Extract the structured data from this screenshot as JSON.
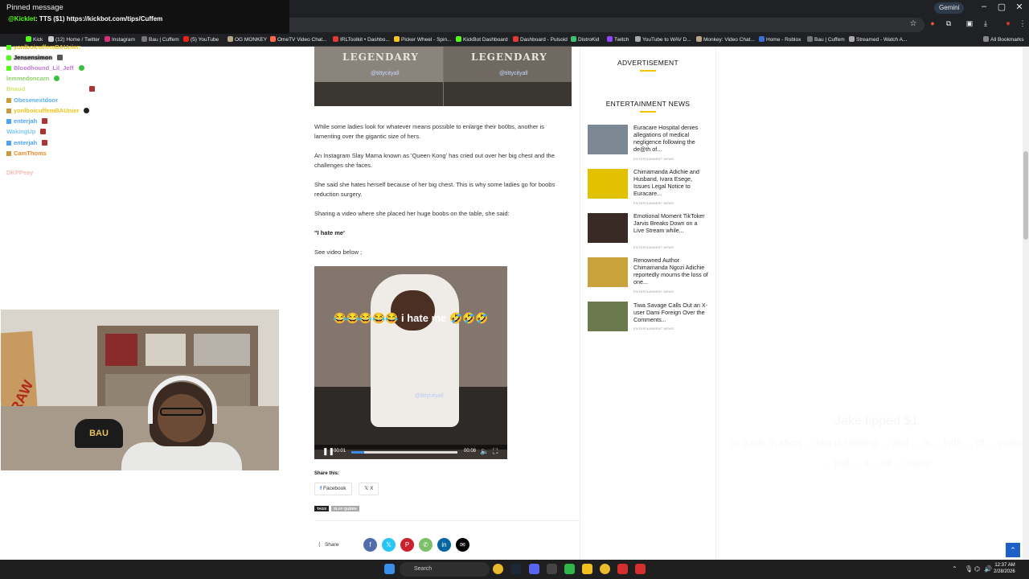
{
  "browser": {
    "url": "...aebidinho.ng/...-slay-mama-... big chest photos/",
    "gemini_label": "Gemini",
    "bookmarks": [
      "Kick",
      "(12) Home / Twitter",
      "Instagram",
      "Bau | Cuffem",
      "(5) YouTube",
      "OG MONKEY",
      "OmeTV Video Chat...",
      "IRLToolkit • Dashbo...",
      "Picker Wheel - Spin...",
      "KickBot Dashboard",
      "Dashboard - Pulsoid",
      "DistroKid",
      "Twitch",
      "YouTube to WAV D...",
      "Monkey: Video Chat...",
      "Home - Roblox",
      "Bau | Cuffem",
      "Streamed - Watch A..."
    ],
    "all_bookmarks": "All Bookmarks"
  },
  "overlay": {
    "pinned_title": "Pinned message",
    "pinned_user": "@Kicklet",
    "pinned_text": ": TTS ($1) https://kickbot.com/tips/Cuffem",
    "chat": [
      {
        "user": "yonlboicuffemBAUnier:",
        "color": "#f0c419"
      },
      {
        "user": "Jensensimon",
        "color": "#e6e6e6"
      },
      {
        "user": "Bloodhound_Lil_Jeff",
        "color": "#c07ad9"
      },
      {
        "user": "lemmedoncarn",
        "color": "#8fd16b"
      },
      {
        "user": "Bnaud",
        "color": "#d7e36c"
      },
      {
        "user": "Obesenextdoor",
        "color": "#5ab0f0"
      },
      {
        "user": "yonlboicuffemBAUnier",
        "color": "#f0c419"
      },
      {
        "user": "enterjah",
        "color": "#4fa3f7"
      },
      {
        "user": "WakingUp",
        "color": "#7ec8f5"
      },
      {
        "user": "enterjah",
        "color": "#4fa3f7"
      },
      {
        "user": "CamThoms",
        "color": "#f08a24"
      },
      {
        "user": "DKPPeay",
        "color": "#e07b6e"
      }
    ],
    "webcam_hat_text": "BAU",
    "webcam_board_text": "RAW",
    "tip_title": "Jake tipped $1",
    "tip_body": "to 0 ads in short ... she is reading ... and ... is ... with ... of ... video ... pull ... a ... of ... video"
  },
  "article": {
    "hero_caption": "LEGENDARY",
    "hero_watermark": "@tittycityall",
    "paragraphs": [
      "While some ladies look for whatever means possible to enlarge their bo0bs, another is lamenting over the gigantic size of hers.",
      "An Instagram Slay Mama known as 'Queen Kong' has cried out over her big chest and the challenges she faces.",
      "She said she hates herself because of her big chest. This is why some ladies go for boobs reduction surgery.",
      "Sharing a video where she placed her huge boobs on the table, she said:"
    ],
    "quote": "\"I hate me'",
    "see_video": "See video below ;",
    "video": {
      "caption": "😂😂😂😂😂 i hate me 🤣🤣🤣",
      "watermark": "@tittycityall",
      "current_time": "00:01",
      "duration": "00:08",
      "progress_fraction": 0.12
    },
    "share_this": "Share this:",
    "share_buttons": [
      "Facebook",
      "X"
    ],
    "tags_label": "TAGS",
    "tag": "SLAY QUEEN",
    "share_label": "Share",
    "share_colors": {
      "facebook": "#516eab",
      "twitter": "#29c5f6",
      "pinterest": "#ca212a",
      "whatsapp": "#7bbf6a",
      "linkedin": "#0266a0",
      "email": "#000000"
    }
  },
  "sidebar": {
    "ad_title": "ADVERTISEMENT",
    "news_title": "ENTERTAINMENT NEWS",
    "news": [
      {
        "title": "Euracare Hospital denies allegations of medical negligence following the de@th of...",
        "category": "ENTERTAINMENT NEWS"
      },
      {
        "title": "Chimamanda Adichie and Husband, Ivara Esege, Issues Legal Notice to Euracare...",
        "category": "ENTERTAINMENT NEWS"
      },
      {
        "title": "Emotional Moment TikToker Jarvis Breaks Down on a Live Stream while...",
        "category": "ENTERTAINMENT NEWS"
      },
      {
        "title": "Renowned Author Chimamanda Ngozi Adichie reportedly mourns the loss of one...",
        "category": "ENTERTAINMENT NEWS"
      },
      {
        "title": "Tiwa Savage Calls Out an X-user Dami Foreign Over the Comments...",
        "category": "ENTERTAINMENT NEWS"
      }
    ]
  },
  "taskbar": {
    "search_placeholder": "Search",
    "time": "12:37 AM",
    "date": "2/28/2026"
  }
}
